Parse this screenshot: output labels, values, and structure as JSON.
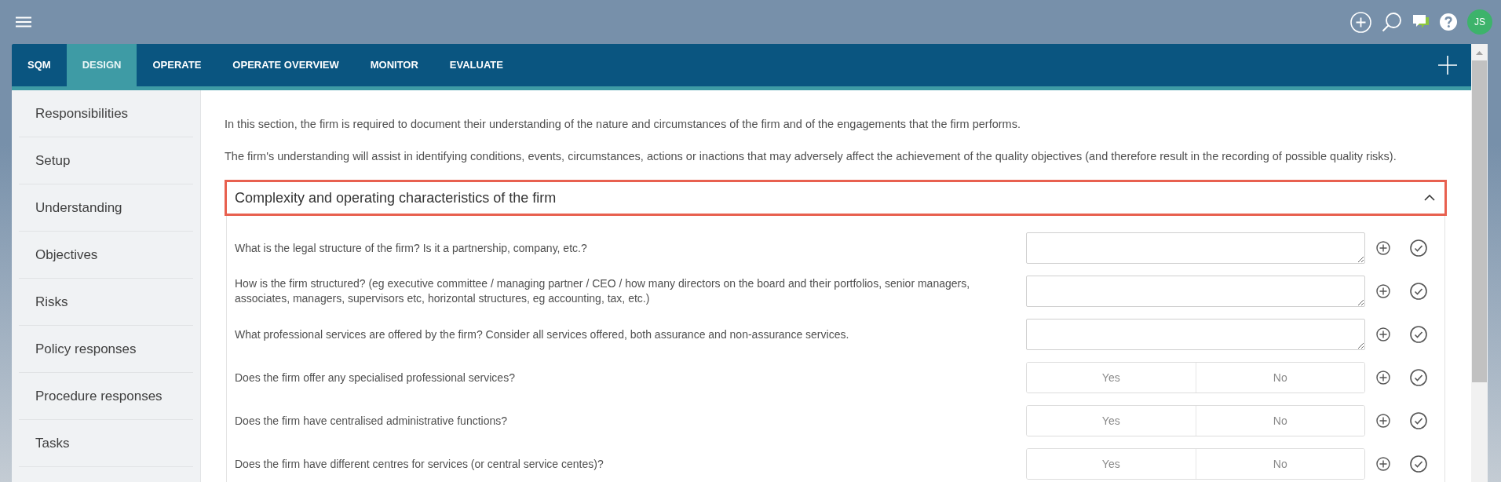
{
  "topbar": {
    "avatar": "JS"
  },
  "tabs": [
    {
      "label": "SQM",
      "selected": false
    },
    {
      "label": "DESIGN",
      "selected": true
    },
    {
      "label": "OPERATE",
      "selected": false
    },
    {
      "label": "OPERATE OVERVIEW",
      "selected": false
    },
    {
      "label": "MONITOR",
      "selected": false
    },
    {
      "label": "EVALUATE",
      "selected": false
    }
  ],
  "sidebar": {
    "items": [
      {
        "label": "Responsibilities"
      },
      {
        "label": "Setup"
      },
      {
        "label": "Understanding"
      },
      {
        "label": "Objectives"
      },
      {
        "label": "Risks"
      },
      {
        "label": "Policy responses"
      },
      {
        "label": "Procedure responses"
      },
      {
        "label": "Tasks"
      }
    ]
  },
  "intro": [
    "In this section, the firm is required to document their understanding of the nature and circumstances of the firm and of the engagements that the firm performs.",
    "The firm's understanding will assist in identifying conditions, events, circumstances, actions or inactions that may adversely affect the achievement of the quality objectives (and therefore result in the recording of possible quality risks)."
  ],
  "section": {
    "title": "Complexity and operating characteristics of the firm",
    "expanded": true,
    "questions": [
      {
        "kind": "text",
        "question": "What is the legal structure of the firm? Is it a partnership, company, etc.?"
      },
      {
        "kind": "text",
        "question": "How is the firm structured? (eg executive committee / managing partner / CEO / how many directors on the board and their portfolios, senior managers, associates, managers, supervisors etc, horizontal structures, eg accounting, tax, etc.)"
      },
      {
        "kind": "text",
        "question": "What professional services are offered by the firm? Consider all services offered, both assurance and non-assurance services."
      },
      {
        "kind": "yes_no",
        "question": "Does the firm offer any specialised professional services?",
        "options": [
          {
            "label": "Yes",
            "selected": false
          },
          {
            "label": "No",
            "selected": false
          }
        ]
      },
      {
        "kind": "yes_no",
        "question": "Does the firm have centralised administrative functions?",
        "options": [
          {
            "label": "Yes",
            "selected": false
          },
          {
            "label": "No",
            "selected": false
          }
        ]
      },
      {
        "kind": "yes_no",
        "question": "Does the firm have different centres for services (or central service centes)?",
        "options": [
          {
            "label": "Yes",
            "selected": false
          },
          {
            "label": "No",
            "selected": false
          }
        ]
      }
    ]
  }
}
